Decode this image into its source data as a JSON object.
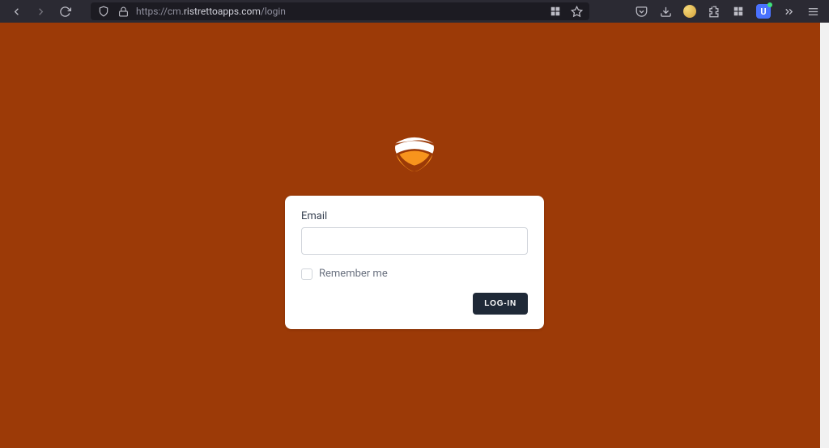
{
  "browser": {
    "url_scheme": "https://",
    "url_host": "cm.",
    "url_domain": "ristrettoapps.com",
    "url_path": "/login",
    "ext_u_letter": "U"
  },
  "login": {
    "email_label": "Email",
    "email_value": "",
    "remember_label": "Remember me",
    "submit_label": "LOG-IN"
  },
  "colors": {
    "page_bg": "#9c3a07",
    "card_bg": "#ffffff",
    "button_bg": "#1f2937",
    "logo_orange": "#f7941d",
    "logo_white": "#ffffff"
  }
}
